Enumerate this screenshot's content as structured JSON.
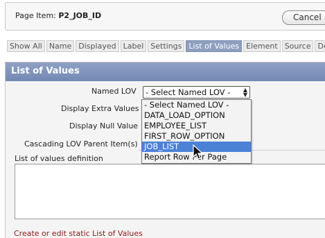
{
  "header": {
    "prefix": "Page Item:",
    "item_name": "P2_JOB_ID",
    "cancel_label": "Cancel"
  },
  "tabs": [
    {
      "label": "Show All"
    },
    {
      "label": "Name"
    },
    {
      "label": "Displayed"
    },
    {
      "label": "Label"
    },
    {
      "label": "Settings"
    },
    {
      "label": "List of Values",
      "active": true
    },
    {
      "label": "Element"
    },
    {
      "label": "Source"
    },
    {
      "label": "Def"
    }
  ],
  "section": {
    "title": "List of Values",
    "named_lov_label": "Named LOV",
    "named_lov_value": "- Select Named LOV -",
    "display_extra_label": "Display Extra Values",
    "display_null_label": "Display Null Value",
    "cascading_label": "Cascading LOV Parent Item(s)",
    "definition_label": "List of values definition",
    "create_link": "Create or edit static List of Values"
  },
  "dropdown": {
    "options": [
      "- Select Named LOV -",
      "DATA_LOAD_OPTION",
      "EMPLOYEE_LIST",
      "FIRST_ROW_OPTION",
      "JOB_LIST",
      "Report Row Per Page"
    ],
    "highlighted": "JOB_LIST"
  }
}
